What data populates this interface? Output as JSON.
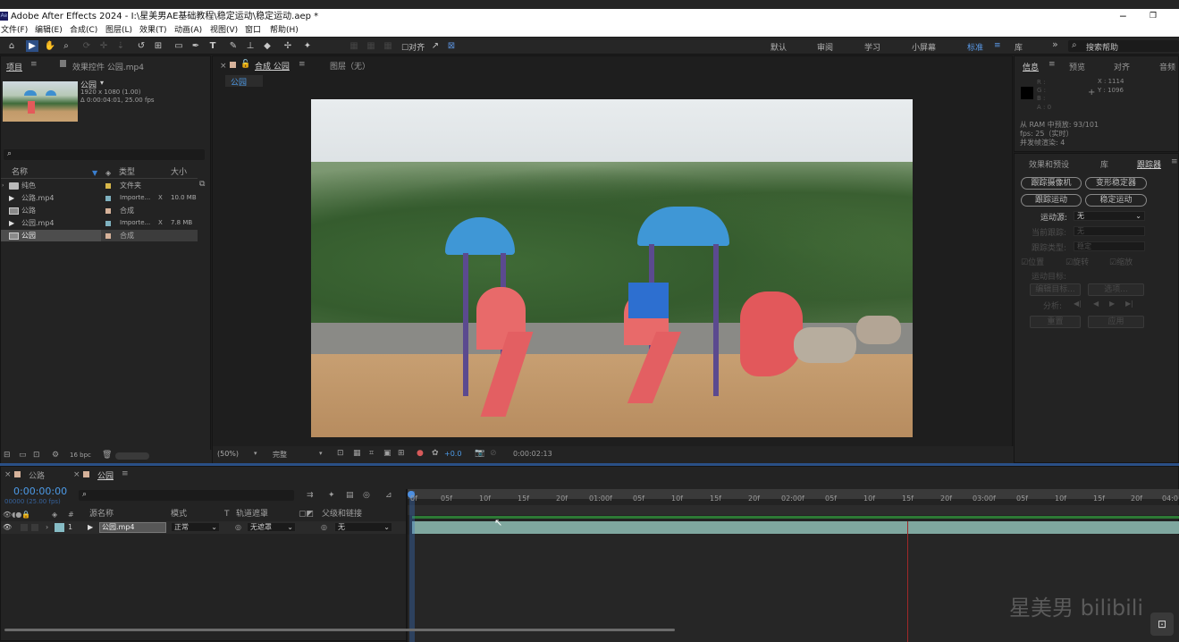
{
  "window": {
    "title": "Adobe After Effects 2024 - I:\\星美男AE基础教程\\稳定运动\\稳定运动.aep *",
    "app_icon": "Ae",
    "minimize": "─",
    "maximize": "❐"
  },
  "menu": [
    "文件(F)",
    "编辑(E)",
    "合成(C)",
    "图层(L)",
    "效果(T)",
    "动画(A)",
    "视图(V)",
    "窗口",
    "帮助(H)"
  ],
  "toolbar": {
    "snap_label": "对齐",
    "workspaces": [
      "默认",
      "审阅",
      "学习",
      "小屏幕",
      "标准",
      "库"
    ],
    "active_workspace": "标准",
    "more": "»",
    "search_placeholder": "搜索帮助"
  },
  "project_panel": {
    "tab_project": "项目",
    "tab_effects": "效果控件 公园.mp4",
    "selected": {
      "name": "公园",
      "resolution": "1920 x 1080 (1.00)",
      "duration": "Δ 0:00:04:01, 25.00 fps"
    },
    "columns": {
      "name": "名称",
      "type": "类型",
      "size": "大小"
    },
    "items": [
      {
        "name": "纯色",
        "type": "文件夹",
        "size": "",
        "color": "#d8b84a"
      },
      {
        "name": "公路.mp4",
        "type": "Importe...",
        "size": "10.0 MB",
        "color": "#7fb2c0"
      },
      {
        "name": "公路",
        "type": "合成",
        "size": "",
        "color": "#d6b29a"
      },
      {
        "name": "公园.mp4",
        "type": "Importe...",
        "size": "7.8 MB",
        "color": "#7fb2c0"
      },
      {
        "name": "公园",
        "type": "合成",
        "size": "",
        "color": "#d6b29a"
      }
    ],
    "bpc": "16 bpc"
  },
  "comp_panel": {
    "tab_comp": "合成 公园",
    "tab_layer": "图层（无）",
    "subtab": "公园",
    "zoom": "(50%)",
    "quality": "完整",
    "exposure": "+0.0",
    "timecode": "0:00:02:13"
  },
  "info_panel": {
    "tabs": [
      "信息",
      "预览",
      "对齐",
      "音频"
    ],
    "r": "R :",
    "g": "G :",
    "b": "B :",
    "a": "A : 0",
    "x": "X : 1114",
    "y": "Y : 1096",
    "cache": "从 RAM 中预放: 93/101",
    "fps": "fps: 25（实时）",
    "concurrent": "并发帧渲染: 4"
  },
  "tracker_panel": {
    "tabs": [
      "效果和预设",
      "库",
      "跟踪器"
    ],
    "track_camera": "跟踪摄像机",
    "warp_stabilizer": "变形稳定器",
    "track_motion": "跟踪运动",
    "stabilize_motion": "稳定运动",
    "motion_source_label": "运动源:",
    "motion_source_value": "无",
    "current_track_label": "当前跟踪:",
    "current_track_value": "无",
    "track_type_label": "跟踪类型:",
    "track_type_value": "稳定",
    "position": "位置",
    "rotation": "旋转",
    "scale": "缩放",
    "motion_target": "运动目标:",
    "edit_target": "编辑目标...",
    "options": "选项...",
    "analyze": "分析:",
    "reset": "重置",
    "apply": "应用"
  },
  "timeline": {
    "tabs": [
      "公路",
      "公园"
    ],
    "timecode": "0:00:00:00",
    "timecode_sub": "00000 (25.00 fps)",
    "col_layer_name": "源名称",
    "col_mode": "模式",
    "col_t": "T",
    "col_track_matte": "轨道遮罩",
    "col_parent": "父级和链接",
    "layer": {
      "num": "1",
      "name": "公园.mp4",
      "mode": "正常",
      "matte": "无遮罩",
      "parent": "无"
    },
    "ticks": [
      "0f",
      "05f",
      "10f",
      "15f",
      "20f",
      "01:00f",
      "05f",
      "10f",
      "15f",
      "20f",
      "02:00f",
      "05f",
      "10f",
      "15f",
      "20f",
      "03:00f",
      "05f",
      "10f",
      "15f",
      "20f",
      "04:0"
    ]
  },
  "watermark": "星美男 bilibili"
}
